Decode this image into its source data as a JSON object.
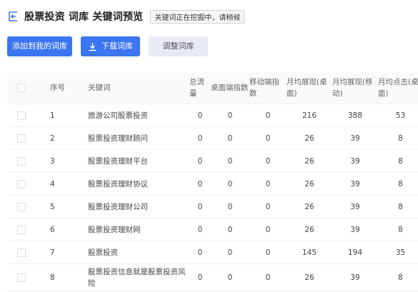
{
  "header": {
    "title": "股票投资 词库 关键词预览",
    "badge": "关键词正在挖掘中，请稍候"
  },
  "toolbar": {
    "add_label": "添加到我的词库",
    "download_label": "下载词库",
    "adjust_label": "调整词库"
  },
  "table": {
    "columns": [
      "序号",
      "关键词",
      "总流量",
      "桌面端指数",
      "移动端指数",
      "月均展现(桌面)",
      "月均展现(移动)",
      "月均点击(桌面)"
    ],
    "rows": [
      {
        "index": "1",
        "keyword": "旅游公司股票投资",
        "total": "0",
        "desktop": "0",
        "mobile": "0",
        "show_pc": "216",
        "show_mobile": "388",
        "click_pc": "53"
      },
      {
        "index": "2",
        "keyword": "股票投资理财顾问",
        "total": "0",
        "desktop": "0",
        "mobile": "0",
        "show_pc": "26",
        "show_mobile": "39",
        "click_pc": "8"
      },
      {
        "index": "3",
        "keyword": "股票投资理财平台",
        "total": "0",
        "desktop": "0",
        "mobile": "0",
        "show_pc": "26",
        "show_mobile": "39",
        "click_pc": "8"
      },
      {
        "index": "4",
        "keyword": "股票投资理财协议",
        "total": "0",
        "desktop": "0",
        "mobile": "0",
        "show_pc": "26",
        "show_mobile": "39",
        "click_pc": "8"
      },
      {
        "index": "5",
        "keyword": "股票投资理财公司",
        "total": "0",
        "desktop": "0",
        "mobile": "0",
        "show_pc": "26",
        "show_mobile": "39",
        "click_pc": "8"
      },
      {
        "index": "6",
        "keyword": "股票投资理财网",
        "total": "0",
        "desktop": "0",
        "mobile": "0",
        "show_pc": "26",
        "show_mobile": "39",
        "click_pc": "8"
      },
      {
        "index": "7",
        "keyword": "股票投资",
        "total": "0",
        "desktop": "0",
        "mobile": "0",
        "show_pc": "145",
        "show_mobile": "194",
        "click_pc": "35"
      },
      {
        "index": "8",
        "keyword": "股票投资信息就是股票投资风险",
        "total": "0",
        "desktop": "0",
        "mobile": "0",
        "show_pc": "26",
        "show_mobile": "39",
        "click_pc": "8"
      }
    ]
  },
  "colors": {
    "primary": "#3b76f0",
    "secondary_button": "#e8eaf4"
  }
}
